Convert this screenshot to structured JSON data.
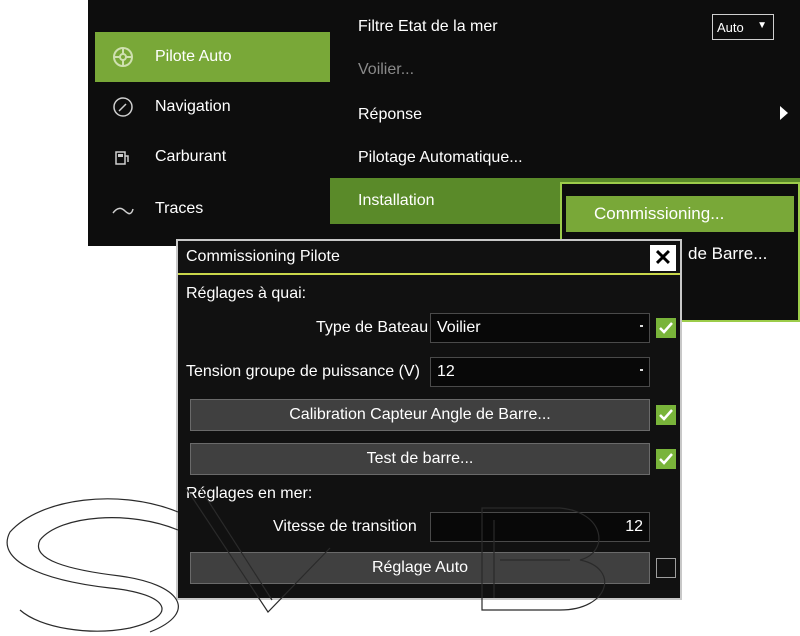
{
  "sidebar": {
    "items": [
      {
        "label": "Pilote Auto",
        "icon": "helm-icon",
        "active": true
      },
      {
        "label": "Navigation",
        "icon": "compass-icon",
        "active": false
      },
      {
        "label": "Carburant",
        "icon": "fuel-pump-icon",
        "active": false
      },
      {
        "label": "Traces",
        "icon": "trail-icon",
        "active": false
      }
    ]
  },
  "menu": {
    "filtre": {
      "label": "Filtre Etat de la mer",
      "value": "Auto"
    },
    "voilier": "Voilier...",
    "reponse": "Réponse",
    "pilotage": "Pilotage Automatique...",
    "installation": "Installation"
  },
  "submenu": {
    "commissioning": "Commissioning...",
    "barre_partial": "de Barre..."
  },
  "dialog": {
    "title": "Commissioning Pilote",
    "close": "✕",
    "quai_heading": "Réglages à quai:",
    "type_bateau_label": "Type de Bateau",
    "type_bateau_value": "Voilier",
    "tension_label": "Tension groupe de puissance (V)",
    "tension_value": "12",
    "calibration_button": "Calibration Capteur Angle de Barre...",
    "test_button": "Test de barre...",
    "mer_heading": "Réglages en mer:",
    "vitesse_label": "Vitesse de transition",
    "vitesse_value": "12",
    "reglage_button": "Réglage Auto"
  },
  "checks": {
    "type_bateau": true,
    "calibration": true,
    "test_barre": true,
    "reglage_auto": false
  },
  "colors": {
    "accent": "#79a838",
    "check": "#79b43a",
    "dialog_bg": "#111111",
    "title_underline": "#c9d64a"
  },
  "watermark": "SVB"
}
